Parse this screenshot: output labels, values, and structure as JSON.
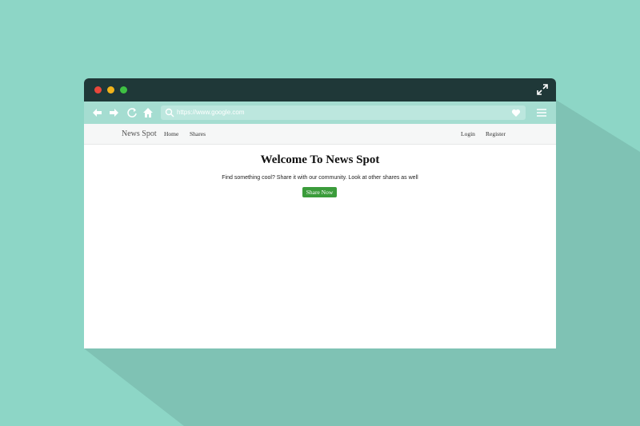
{
  "browser": {
    "url": "https://www.google.com",
    "icons": [
      "back-arrow-icon",
      "forward-arrow-icon",
      "reload-icon",
      "home-icon",
      "search-icon",
      "heart-icon",
      "hamburger-menu-icon",
      "expand-icon"
    ]
  },
  "navbar": {
    "brand": "News Spot",
    "left_links": [
      "Home",
      "Shares"
    ],
    "right_links": [
      "Login",
      "Register"
    ]
  },
  "hero": {
    "title": "Welcome To News Spot",
    "subtitle": "Find something cool? Share it with our community. Look at other shares as well",
    "button_label": "Share Now"
  },
  "colors": {
    "background": "#8dd6c6",
    "titlebar": "#1f3838",
    "toolbar": "#a5ddd1",
    "button": "#3b9c3b"
  }
}
